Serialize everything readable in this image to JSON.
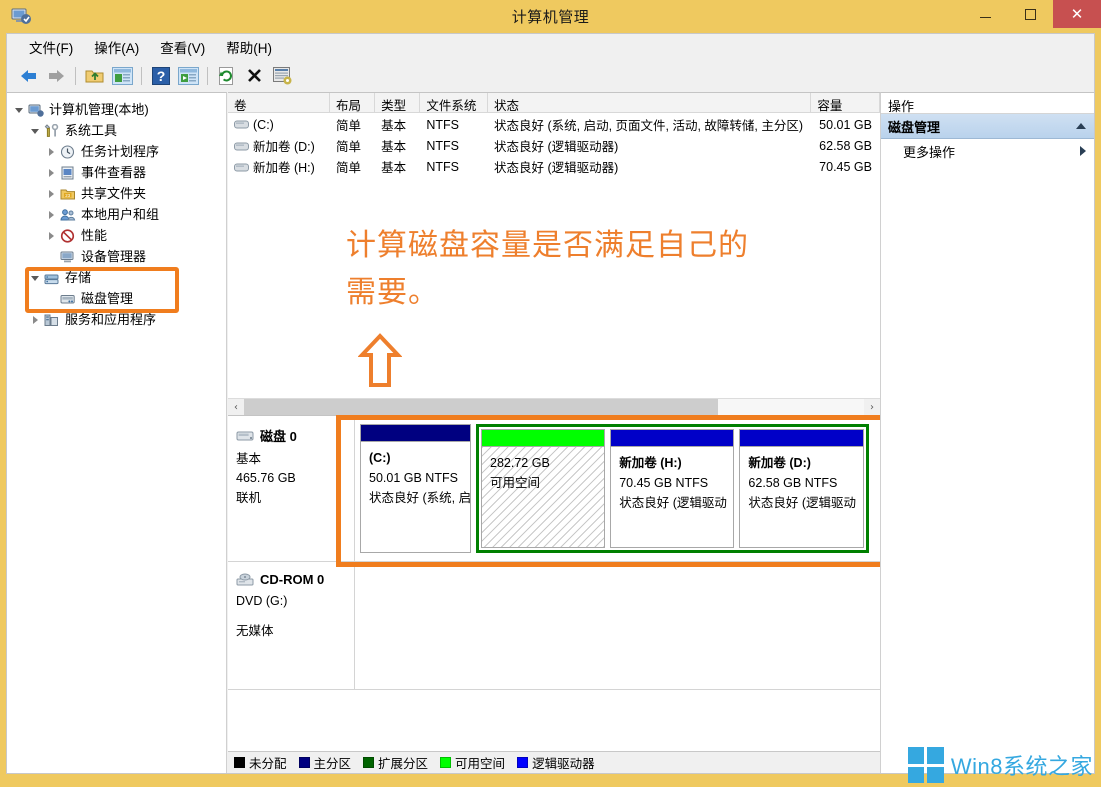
{
  "window": {
    "title": "计算机管理",
    "icon": "computer-management-icon",
    "minimize_label": "最小化",
    "maximize_label": "最大化",
    "close_label": "关闭"
  },
  "menubar": {
    "items": [
      {
        "label": "文件(F)",
        "name": "menu-file"
      },
      {
        "label": "操作(A)",
        "name": "menu-action"
      },
      {
        "label": "查看(V)",
        "name": "menu-view"
      },
      {
        "label": "帮助(H)",
        "name": "menu-help"
      }
    ]
  },
  "toolbar": {
    "buttons": [
      {
        "name": "back-icon",
        "label": "后退"
      },
      {
        "name": "forward-icon",
        "label": "前进"
      },
      {
        "name": "up-folder-icon",
        "label": "向上"
      },
      {
        "name": "show-hide-tree-icon",
        "label": "显示/隐藏控制台树"
      },
      {
        "name": "help-icon",
        "label": "帮助"
      },
      {
        "name": "show-action-pane-icon",
        "label": "显示/隐藏操作窗格"
      },
      {
        "name": "refresh-icon",
        "label": "刷新"
      },
      {
        "name": "delete-icon",
        "label": "删除"
      },
      {
        "name": "properties-script-icon",
        "label": "导出列表"
      }
    ]
  },
  "tree": {
    "items": [
      {
        "label": "计算机管理(本地)",
        "indent": 0,
        "expander": "open",
        "icon": "computer-icon",
        "name": "tree-item-computer-management"
      },
      {
        "label": "系统工具",
        "indent": 1,
        "expander": "open",
        "icon": "tools-icon",
        "name": "tree-item-system-tools"
      },
      {
        "label": "任务计划程序",
        "indent": 2,
        "expander": "closed",
        "icon": "clock-icon",
        "name": "tree-item-task-scheduler"
      },
      {
        "label": "事件查看器",
        "indent": 2,
        "expander": "closed",
        "icon": "event-viewer-icon",
        "name": "tree-item-event-viewer"
      },
      {
        "label": "共享文件夹",
        "indent": 2,
        "expander": "closed",
        "icon": "shared-folders-icon",
        "name": "tree-item-shared-folders"
      },
      {
        "label": "本地用户和组",
        "indent": 2,
        "expander": "closed",
        "icon": "users-icon",
        "name": "tree-item-local-users-groups"
      },
      {
        "label": "性能",
        "indent": 2,
        "expander": "closed",
        "icon": "performance-icon",
        "name": "tree-item-performance"
      },
      {
        "label": "设备管理器",
        "indent": 2,
        "expander": "none",
        "icon": "device-manager-icon",
        "name": "tree-item-device-manager"
      },
      {
        "label": "存储",
        "indent": 1,
        "expander": "open",
        "icon": "storage-icon",
        "name": "tree-item-storage"
      },
      {
        "label": "磁盘管理",
        "indent": 2,
        "expander": "none",
        "icon": "disk-management-icon",
        "name": "tree-item-disk-management"
      },
      {
        "label": "服务和应用程序",
        "indent": 1,
        "expander": "closed",
        "icon": "services-icon",
        "name": "tree-item-services-applications"
      }
    ]
  },
  "volume_list": {
    "columns": [
      {
        "label": "卷",
        "name": "col-volume"
      },
      {
        "label": "布局",
        "name": "col-layout"
      },
      {
        "label": "类型",
        "name": "col-type"
      },
      {
        "label": "文件系统",
        "name": "col-filesystem"
      },
      {
        "label": "状态",
        "name": "col-status"
      },
      {
        "label": "容量",
        "name": "col-capacity"
      }
    ],
    "rows": [
      {
        "volume": "(C:)",
        "layout": "简单",
        "type": "基本",
        "filesystem": "NTFS",
        "status": "状态良好 (系统, 启动, 页面文件, 活动, 故障转储, 主分区)",
        "capacity": "50.01 GB"
      },
      {
        "volume": "新加卷 (D:)",
        "layout": "简单",
        "type": "基本",
        "filesystem": "NTFS",
        "status": "状态良好 (逻辑驱动器)",
        "capacity": "62.58 GB"
      },
      {
        "volume": "新加卷 (H:)",
        "layout": "简单",
        "type": "基本",
        "filesystem": "NTFS",
        "status": "状态良好 (逻辑驱动器)",
        "capacity": "70.45 GB"
      }
    ]
  },
  "annotation": {
    "text": "计算磁盘容量是否满足自己的\n需要。",
    "color": "#ee7f2d",
    "arrow": "up-arrow-annotation",
    "highlight_tree": "存储 / 磁盘管理",
    "highlight_disk": "磁盘 0 分区图"
  },
  "graph_view": {
    "disks": [
      {
        "name": "磁盘 0",
        "icon": "disk-icon",
        "lines": [
          "基本",
          "465.76 GB",
          "联机"
        ],
        "partitions": [
          {
            "name": "(C:)",
            "size": "50.01 GB  NTFS",
            "status": "状态良好 (系统, 启",
            "bar_color": "#000080",
            "kind": "primary",
            "width_pct": 21.6,
            "el_name": "partition-c"
          },
          {
            "name": "",
            "size": "282.72 GB",
            "status": "可用空间",
            "bar_color": "#00ff00",
            "kind": "free",
            "width_pct": 22.9,
            "el_name": "partition-free-space"
          },
          {
            "name": "新加卷  (H:)",
            "size": "70.45 GB  NTFS",
            "status": "状态良好 (逻辑驱动",
            "bar_color": "#0000c8",
            "kind": "logical",
            "width_pct": 24.6,
            "el_name": "partition-h"
          },
          {
            "name": "新加卷  (D:)",
            "size": "62.58 GB  NTFS",
            "status": "状态良好 (逻辑驱动",
            "bar_color": "#0000c8",
            "kind": "logical",
            "width_pct": 24.6,
            "el_name": "partition-d"
          }
        ]
      },
      {
        "name": "CD-ROM 0",
        "icon": "cdrom-icon",
        "lines": [
          "DVD (G:)",
          "",
          "无媒体"
        ],
        "partitions": []
      }
    ]
  },
  "legend": {
    "items": [
      {
        "label": "未分配",
        "color": "#000000",
        "name": "legend-unallocated"
      },
      {
        "label": "主分区",
        "color": "#000080",
        "name": "legend-primary-partition"
      },
      {
        "label": "扩展分区",
        "color": "#006400",
        "name": "legend-extended-partition"
      },
      {
        "label": "可用空间",
        "color": "#00ff00",
        "name": "legend-free-space"
      },
      {
        "label": "逻辑驱动器",
        "color": "#0000ff",
        "name": "legend-logical-drive"
      }
    ]
  },
  "actions_pane": {
    "header": "操作",
    "group": "磁盘管理",
    "items": [
      {
        "label": "更多操作",
        "name": "action-more-actions"
      }
    ]
  },
  "watermark": {
    "text": "Win8系统之家",
    "logo": "windows-logo-icon",
    "color": "#35a8e0"
  },
  "scrollbar": {
    "left_arrow": "‹",
    "right_arrow": "›"
  }
}
